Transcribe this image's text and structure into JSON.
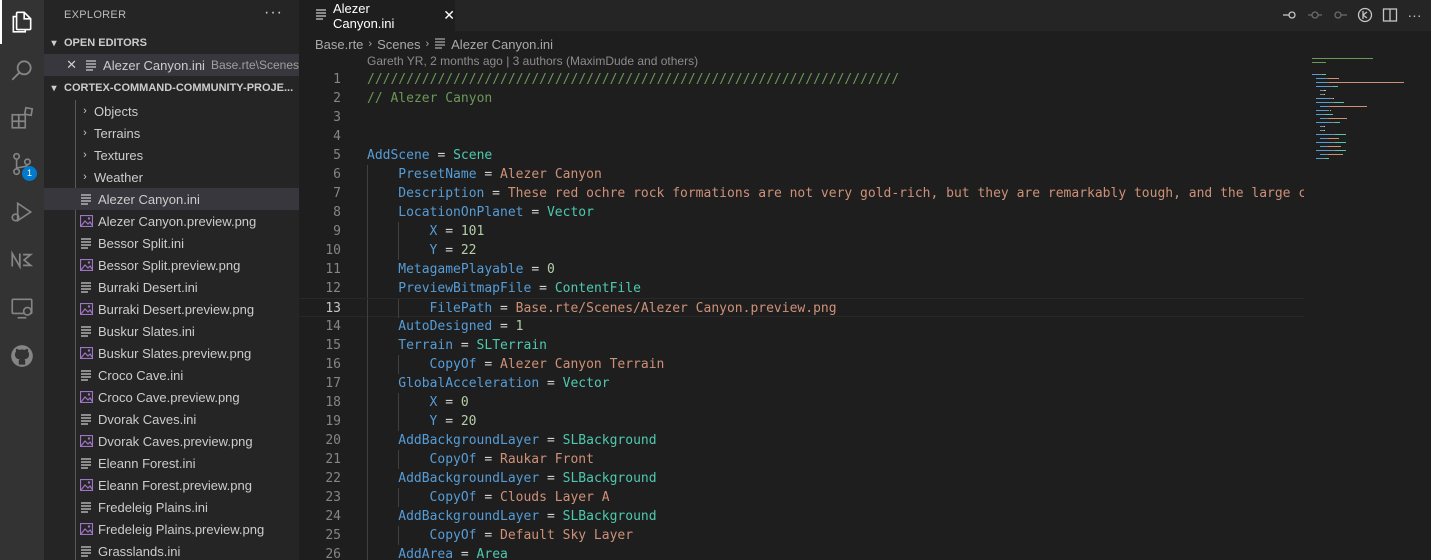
{
  "activity": {
    "scm_badge": "1"
  },
  "sidebar": {
    "title": "EXPLORER",
    "more": "···",
    "open_editors": {
      "label": "OPEN EDITORS",
      "items": [
        {
          "name": "Alezer Canyon.ini",
          "path": "Base.rte\\Scenes"
        }
      ]
    },
    "project": {
      "label": "CORTEX-COMMAND-COMMUNITY-PROJE..."
    },
    "folders": [
      "Objects",
      "Terrains",
      "Textures",
      "Weather"
    ],
    "files": [
      {
        "name": "Alezer Canyon.ini",
        "type": "ini",
        "selected": true
      },
      {
        "name": "Alezer Canyon.preview.png",
        "type": "png"
      },
      {
        "name": "Bessor Split.ini",
        "type": "ini"
      },
      {
        "name": "Bessor Split.preview.png",
        "type": "png"
      },
      {
        "name": "Burraki Desert.ini",
        "type": "ini"
      },
      {
        "name": "Burraki Desert.preview.png",
        "type": "png"
      },
      {
        "name": "Buskur Slates.ini",
        "type": "ini"
      },
      {
        "name": "Buskur Slates.preview.png",
        "type": "png"
      },
      {
        "name": "Croco Cave.ini",
        "type": "ini"
      },
      {
        "name": "Croco Cave.preview.png",
        "type": "png"
      },
      {
        "name": "Dvorak Caves.ini",
        "type": "ini"
      },
      {
        "name": "Dvorak Caves.preview.png",
        "type": "png"
      },
      {
        "name": "Eleann Forest.ini",
        "type": "ini"
      },
      {
        "name": "Eleann Forest.preview.png",
        "type": "png"
      },
      {
        "name": "Fredeleig Plains.ini",
        "type": "ini"
      },
      {
        "name": "Fredeleig Plains.preview.png",
        "type": "png"
      },
      {
        "name": "Grasslands.ini",
        "type": "ini"
      }
    ]
  },
  "editor": {
    "tab_label": "Alezer Canyon.ini",
    "breadcrumb": [
      "Base.rte",
      "Scenes",
      "Alezer Canyon.ini"
    ],
    "blame": "Gareth YR, 2 months ago | 3 authors (MaximDude and others)",
    "current_line": 13,
    "lines": [
      {
        "n": "1",
        "i": 0,
        "segs": [
          [
            "c",
            "////////////////////////////////////////////////////////////////////"
          ]
        ]
      },
      {
        "n": "2",
        "i": 0,
        "segs": [
          [
            "c",
            "// Alezer Canyon"
          ]
        ]
      },
      {
        "n": "3",
        "i": 0,
        "segs": []
      },
      {
        "n": "4",
        "i": 0,
        "segs": []
      },
      {
        "n": "5",
        "i": 0,
        "segs": [
          [
            "k",
            "AddScene"
          ],
          [
            "p",
            " = "
          ],
          [
            "t",
            "Scene"
          ]
        ]
      },
      {
        "n": "6",
        "i": 1,
        "segs": [
          [
            "k",
            "PresetName"
          ],
          [
            "p",
            " = "
          ],
          [
            "v",
            "Alezer Canyon"
          ]
        ]
      },
      {
        "n": "7",
        "i": 1,
        "segs": [
          [
            "k",
            "Description"
          ],
          [
            "p",
            " = "
          ],
          [
            "v",
            "These red ochre rock formations are not very gold-rich, but they are remarkably tough, and the large cav"
          ]
        ]
      },
      {
        "n": "8",
        "i": 1,
        "segs": [
          [
            "k",
            "LocationOnPlanet"
          ],
          [
            "p",
            " = "
          ],
          [
            "t",
            "Vector"
          ]
        ]
      },
      {
        "n": "9",
        "i": 2,
        "segs": [
          [
            "k",
            "X"
          ],
          [
            "p",
            " = "
          ],
          [
            "n",
            "101"
          ]
        ]
      },
      {
        "n": "10",
        "i": 2,
        "segs": [
          [
            "k",
            "Y"
          ],
          [
            "p",
            " = "
          ],
          [
            "n",
            "22"
          ]
        ]
      },
      {
        "n": "11",
        "i": 1,
        "segs": [
          [
            "k",
            "MetagamePlayable"
          ],
          [
            "p",
            " = "
          ],
          [
            "n",
            "0"
          ]
        ]
      },
      {
        "n": "12",
        "i": 1,
        "segs": [
          [
            "k",
            "PreviewBitmapFile"
          ],
          [
            "p",
            " = "
          ],
          [
            "t",
            "ContentFile"
          ]
        ]
      },
      {
        "n": "13",
        "i": 2,
        "segs": [
          [
            "k",
            "FilePath"
          ],
          [
            "p",
            " = "
          ],
          [
            "v",
            "Base.rte/Scenes/Alezer Canyon.preview.png"
          ]
        ]
      },
      {
        "n": "14",
        "i": 1,
        "segs": [
          [
            "k",
            "AutoDesigned"
          ],
          [
            "p",
            " = "
          ],
          [
            "n",
            "1"
          ]
        ]
      },
      {
        "n": "15",
        "i": 1,
        "segs": [
          [
            "k",
            "Terrain"
          ],
          [
            "p",
            " = "
          ],
          [
            "t",
            "SLTerrain"
          ]
        ]
      },
      {
        "n": "16",
        "i": 2,
        "segs": [
          [
            "k",
            "CopyOf"
          ],
          [
            "p",
            " = "
          ],
          [
            "v",
            "Alezer Canyon Terrain"
          ]
        ]
      },
      {
        "n": "17",
        "i": 1,
        "segs": [
          [
            "k",
            "GlobalAcceleration"
          ],
          [
            "p",
            " = "
          ],
          [
            "t",
            "Vector"
          ]
        ]
      },
      {
        "n": "18",
        "i": 2,
        "segs": [
          [
            "k",
            "X"
          ],
          [
            "p",
            " = "
          ],
          [
            "n",
            "0"
          ]
        ]
      },
      {
        "n": "19",
        "i": 2,
        "segs": [
          [
            "k",
            "Y"
          ],
          [
            "p",
            " = "
          ],
          [
            "n",
            "20"
          ]
        ]
      },
      {
        "n": "20",
        "i": 1,
        "segs": [
          [
            "k",
            "AddBackgroundLayer"
          ],
          [
            "p",
            " = "
          ],
          [
            "t",
            "SLBackground"
          ]
        ]
      },
      {
        "n": "21",
        "i": 2,
        "segs": [
          [
            "k",
            "CopyOf"
          ],
          [
            "p",
            " = "
          ],
          [
            "v",
            "Raukar Front"
          ]
        ]
      },
      {
        "n": "22",
        "i": 1,
        "segs": [
          [
            "k",
            "AddBackgroundLayer"
          ],
          [
            "p",
            " = "
          ],
          [
            "t",
            "SLBackground"
          ]
        ]
      },
      {
        "n": "23",
        "i": 2,
        "segs": [
          [
            "k",
            "CopyOf"
          ],
          [
            "p",
            " = "
          ],
          [
            "v",
            "Clouds Layer A"
          ]
        ]
      },
      {
        "n": "24",
        "i": 1,
        "segs": [
          [
            "k",
            "AddBackgroundLayer"
          ],
          [
            "p",
            " = "
          ],
          [
            "t",
            "SLBackground"
          ]
        ]
      },
      {
        "n": "25",
        "i": 2,
        "segs": [
          [
            "k",
            "CopyOf"
          ],
          [
            "p",
            " = "
          ],
          [
            "v",
            "Default Sky Layer"
          ]
        ]
      },
      {
        "n": "26",
        "i": 1,
        "segs": [
          [
            "k",
            "AddArea"
          ],
          [
            "p",
            " = "
          ],
          [
            "t",
            "Area"
          ]
        ]
      }
    ]
  },
  "colors": {
    "keyword": "#569cd6",
    "string": "#ce9178",
    "type": "#4ec9b0",
    "comment": "#6a9955",
    "number": "#b5cea8",
    "accent": "#007acc"
  }
}
